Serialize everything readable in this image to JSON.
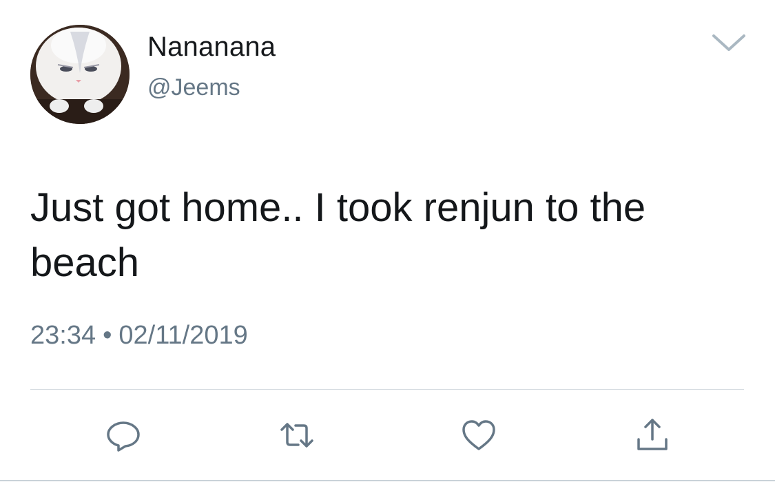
{
  "user": {
    "display_name": "Nananana",
    "handle": "@Jeems"
  },
  "tweet": {
    "text": "Just got home.. I took renjun to the beach",
    "time": "23:34",
    "separator": "•",
    "date": "02/11/2019"
  },
  "icons": {
    "avatar": "white-bunny-avatar",
    "menu": "chevron-down-icon",
    "reply": "reply-icon",
    "retweet": "retweet-icon",
    "like": "heart-icon",
    "share": "share-icon"
  },
  "colors": {
    "text_primary": "#14171a",
    "text_secondary": "#657786",
    "icon_gray": "#657786",
    "divider": "#d4dbe0",
    "background": "#ffffff"
  }
}
